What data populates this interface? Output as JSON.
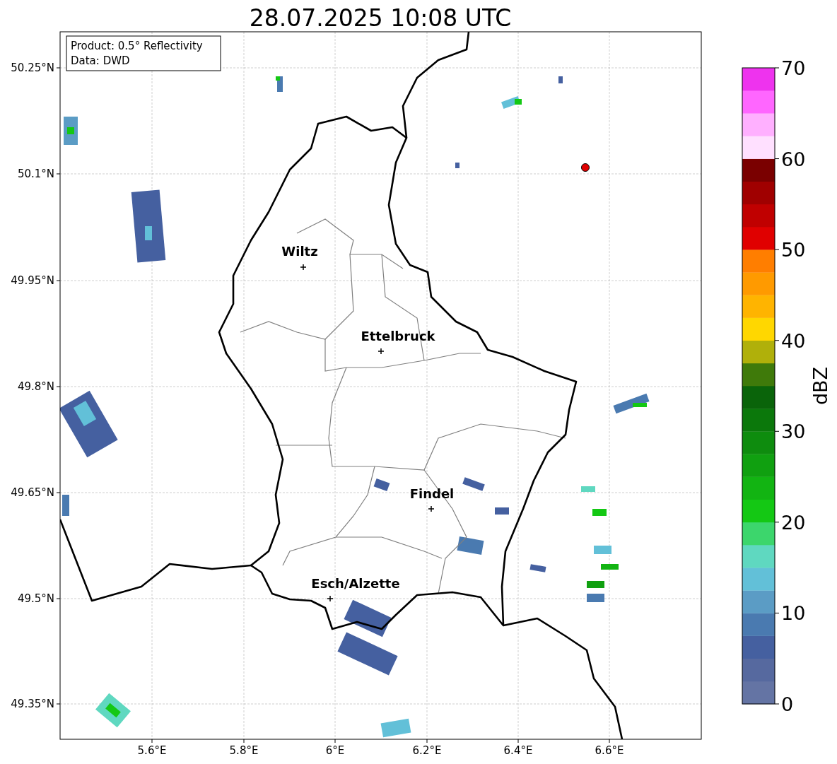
{
  "title": "28.07.2025 10:08 UTC",
  "info_box": [
    "Product: 0.5° Reflectivity",
    "Data: DWD"
  ],
  "map": {
    "cities": [
      {
        "name": "Wiltz"
      },
      {
        "name": "Ettelbruck"
      },
      {
        "name": "Findel"
      },
      {
        "name": "Esch/Alzette"
      }
    ],
    "x_tick_labels": [
      "5.6°E",
      "5.8°E",
      "6°E",
      "6.2°E",
      "6.4°E",
      "6.6°E"
    ],
    "y_tick_labels": [
      "50.25°N",
      "50.1°N",
      "49.95°N",
      "49.8°N",
      "49.65°N",
      "49.5°N",
      "49.35°N"
    ]
  },
  "colorbar": {
    "label": "dBZ",
    "tick_labels": [
      "70",
      "60",
      "50",
      "40",
      "30",
      "20",
      "10",
      "0"
    ],
    "bins": [
      {
        "color": "#6474a4"
      },
      {
        "color": "#56699f"
      },
      {
        "color": "#4560a0"
      },
      {
        "color": "#4a7ab0"
      },
      {
        "color": "#5b9cc5"
      },
      {
        "color": "#62c0d8"
      },
      {
        "color": "#5fd8c0"
      },
      {
        "color": "#3cd66c"
      },
      {
        "color": "#14c814"
      },
      {
        "color": "#12b412"
      },
      {
        "color": "#10a010"
      },
      {
        "color": "#0e8c0e"
      },
      {
        "color": "#0b780b"
      },
      {
        "color": "#0a640a"
      },
      {
        "color": "#3f7a0a"
      },
      {
        "color": "#b0b00a"
      },
      {
        "color": "#ffd700"
      },
      {
        "color": "#ffb400"
      },
      {
        "color": "#ff9a00"
      },
      {
        "color": "#ff7e00"
      },
      {
        "color": "#e00000"
      },
      {
        "color": "#c00000"
      },
      {
        "color": "#a00000"
      },
      {
        "color": "#7a0000"
      },
      {
        "color": "#ffe0ff"
      },
      {
        "color": "#ffb0ff"
      },
      {
        "color": "#ff66ff"
      },
      {
        "color": "#ee33ee"
      }
    ]
  }
}
